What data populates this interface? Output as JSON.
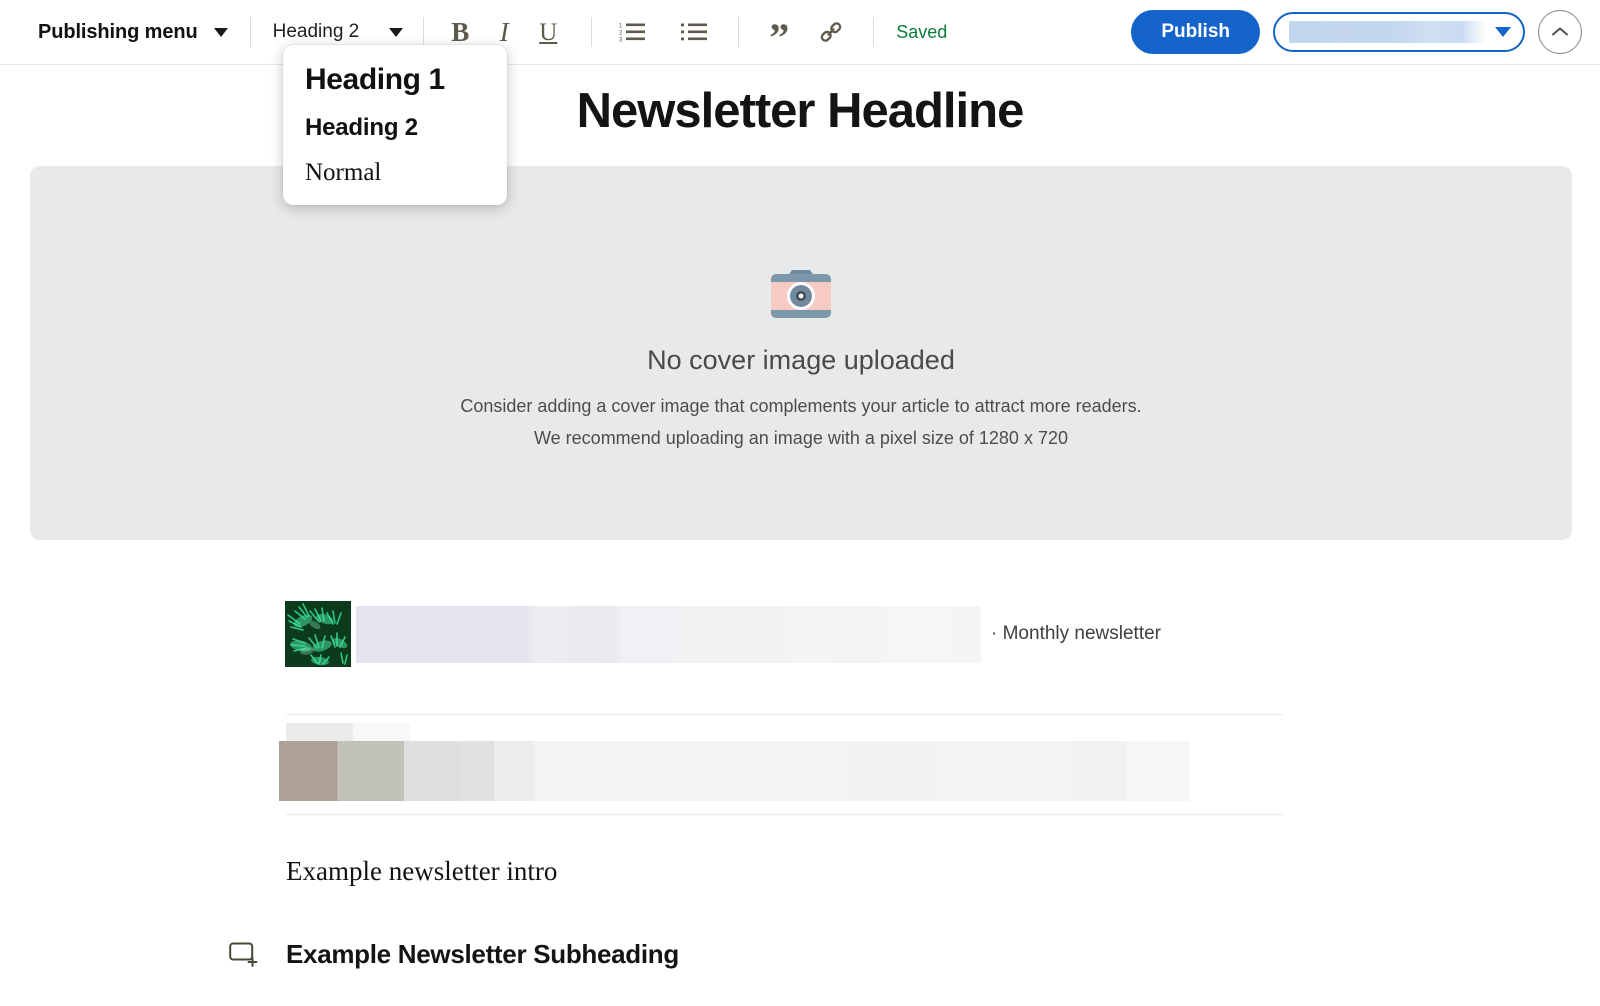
{
  "toolbar": {
    "publishing_menu_label": "Publishing menu",
    "publishing_menu_caret": "chevron-down-icon",
    "style_picker_value": "Heading 2",
    "style_picker_caret": "chevron-down-icon",
    "format_buttons": [
      {
        "name": "bold-button",
        "glyph": "B"
      },
      {
        "name": "italic-button",
        "glyph": "I"
      },
      {
        "name": "underline-button",
        "glyph": "U"
      }
    ],
    "list_buttons": [
      {
        "name": "numbered-list-button"
      },
      {
        "name": "bulleted-list-button"
      }
    ],
    "insert_buttons": [
      {
        "name": "blockquote-button",
        "glyph": "”"
      },
      {
        "name": "link-button"
      }
    ],
    "saved_status": "Saved",
    "publish_label": "Publish",
    "account_select_value": "",
    "collapse_button": "chevron-up-icon",
    "accent_color": "#1464cc",
    "saved_color": "#0d7c3b",
    "icon_color": "#5e5a4c"
  },
  "style_dropdown": {
    "open": true,
    "items": [
      {
        "label": "Heading 1",
        "style": "h1"
      },
      {
        "label": "Heading 2",
        "style": "h2"
      },
      {
        "label": "Normal",
        "style": "normal"
      }
    ]
  },
  "document": {
    "headline": "Newsletter Headline",
    "cover": {
      "icon": "camera-icon",
      "title": "No cover image uploaded",
      "subtitle_line1": "Consider adding a cover image that complements your article to attract more readers.",
      "subtitle_line2": "We recommend uploading an image with a pixel size of 1280 x 720",
      "background_color": "#e8e9ea"
    },
    "byline": {
      "thumbnail": "plant-leaves-thumbnail",
      "redacted_author": "",
      "separator": "·",
      "publication": "Monthly newsletter"
    },
    "body_block": {
      "redacted": true
    },
    "intro_paragraph": "Example newsletter intro",
    "subheading": {
      "icon": "add-block-icon",
      "text": "Example Newsletter Subheading"
    }
  }
}
